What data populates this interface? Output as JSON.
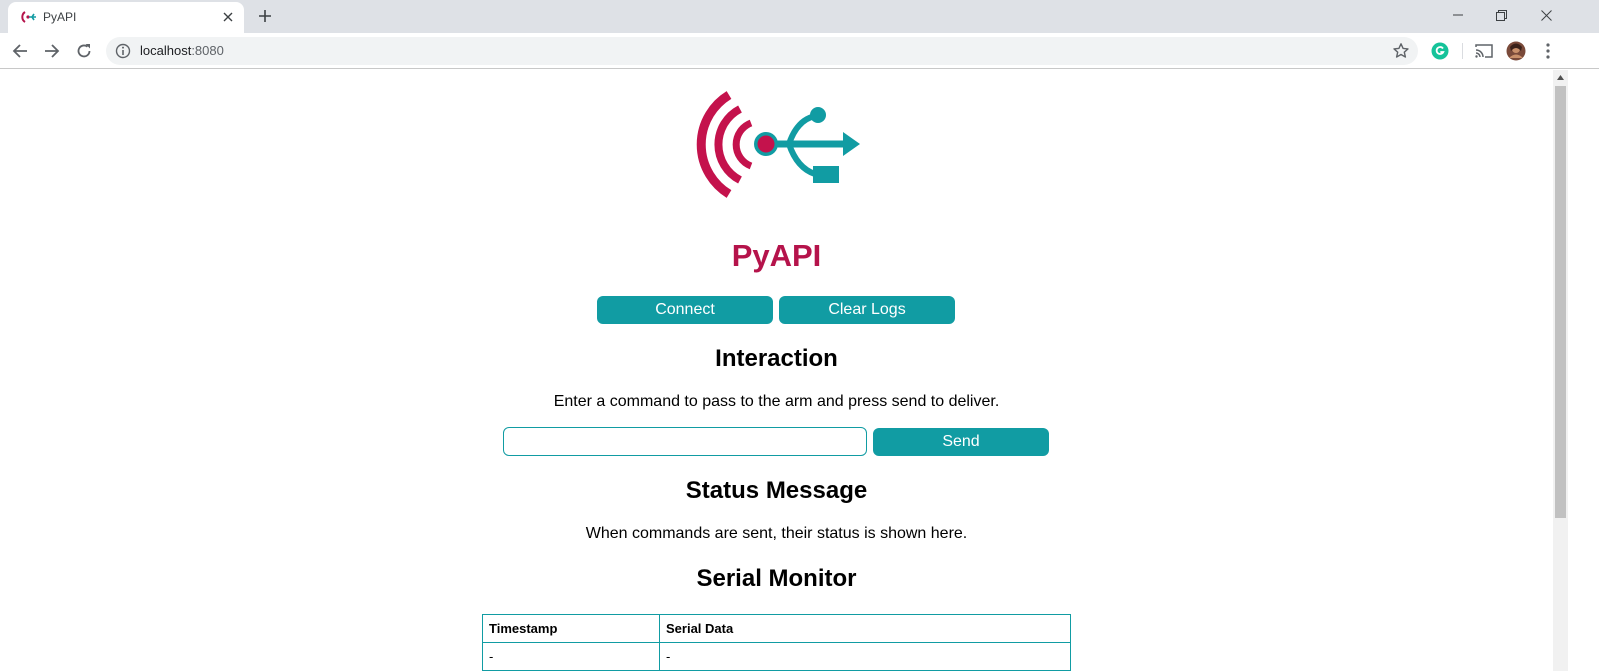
{
  "browser": {
    "tab_title": "PyAPI",
    "url_host": "localhost",
    "url_port": ":8080"
  },
  "page": {
    "title": "PyAPI",
    "buttons": {
      "connect": "Connect",
      "clear_logs": "Clear Logs",
      "send": "Send"
    },
    "interaction": {
      "heading": "Interaction",
      "description": "Enter a command to pass to the arm and press send to deliver.",
      "command_value": ""
    },
    "status": {
      "heading": "Status Message",
      "description": "When commands are sent, their status is shown here."
    },
    "serial_monitor": {
      "heading": "Serial Monitor",
      "columns": [
        "Timestamp",
        "Serial Data"
      ],
      "rows": [
        [
          "-",
          "-"
        ]
      ]
    }
  },
  "colors": {
    "accent": "#119ca3",
    "brand": "#b5134b"
  }
}
